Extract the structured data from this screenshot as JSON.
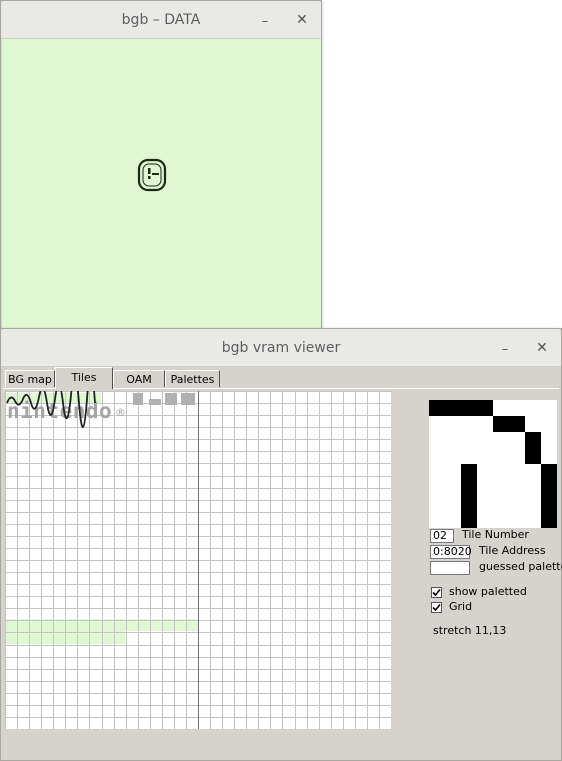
{
  "data_window": {
    "title": "bgb – DATA",
    "minimize_glyph": "–",
    "close_glyph": "✕",
    "screen_color": "#dff7d2"
  },
  "vram_window": {
    "title": "bgb vram viewer",
    "minimize_glyph": "–",
    "close_glyph": "✕",
    "tabs": [
      {
        "label": "BG map",
        "active": false
      },
      {
        "label": "Tiles",
        "active": true
      },
      {
        "label": "OAM",
        "active": false
      },
      {
        "label": "Palettes",
        "active": false
      }
    ],
    "tile_number": "02",
    "tile_number_label": "Tile Number",
    "tile_address": "0:8020",
    "tile_address_label": "Tile Address",
    "guessed_palette_value": "",
    "guessed_palette_label": "guessed palette",
    "show_paletted_label": "show paletted",
    "show_paletted_checked": true,
    "grid_label": "Grid",
    "grid_checked": true,
    "stretch_text": "stretch 11,13",
    "logo_text": "nintendo",
    "highlight_color": "#dff7d2"
  },
  "icons": [
    "smiley-face-icon",
    "check-icon"
  ]
}
